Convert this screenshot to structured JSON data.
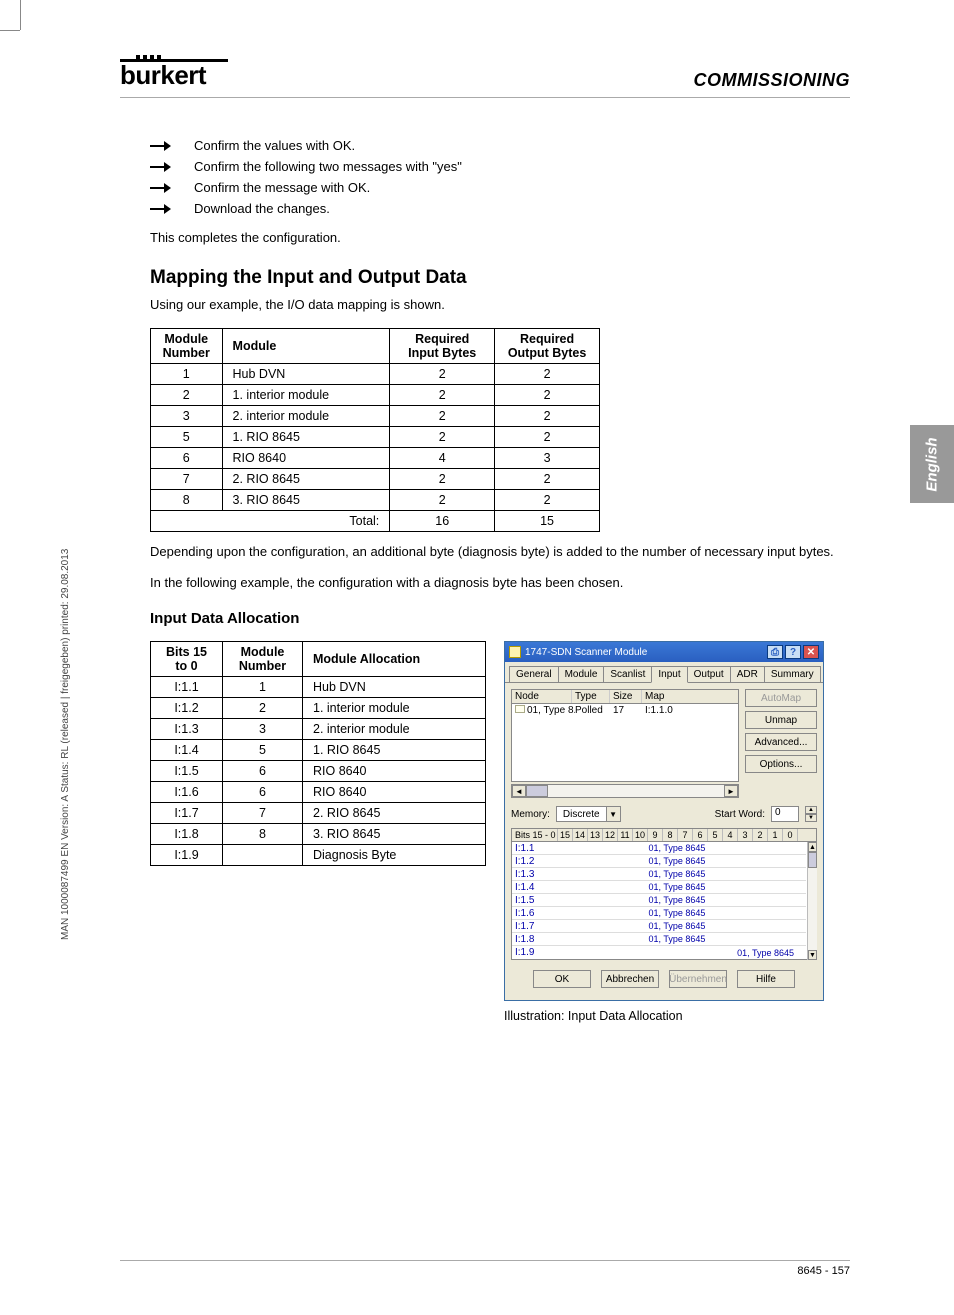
{
  "brand": "burkert",
  "section_title": "COMMISSIONING",
  "side_note": "MAN 1000087499 EN Version: A Status: RL (released | freigegeben) printed: 29.08.2013",
  "lang_tab": "English",
  "steps": [
    "Confirm the values with OK.",
    "Confirm the following two messages with \"yes\"",
    "Confirm the message with OK.",
    "Download the changes."
  ],
  "after_steps": "This completes the configuration.",
  "h2": "Mapping the Input and Output Data",
  "intro_para": "Using our example, the I/O data mapping is shown.",
  "table1": {
    "headers": [
      "Module Number",
      "Module",
      "Required Input Bytes",
      "Required Output Bytes"
    ],
    "rows": [
      [
        "1",
        "Hub DVN",
        "2",
        "2"
      ],
      [
        "2",
        "1. interior module",
        "2",
        "2"
      ],
      [
        "3",
        "2. interior module",
        "2",
        "2"
      ],
      [
        "5",
        "1. RIO 8645",
        "2",
        "2"
      ],
      [
        "6",
        "RIO 8640",
        "4",
        "3"
      ],
      [
        "7",
        "2. RIO 8645",
        "2",
        "2"
      ],
      [
        "8",
        "3. RIO 8645",
        "2",
        "2"
      ]
    ],
    "total_row": [
      "",
      "Total:",
      "16",
      "15"
    ]
  },
  "para_after_t1a": "Depending upon the configuration, an additional byte (diagnosis byte) is added to the number of necessary input bytes.",
  "para_after_t1b": "In the following example, the configuration with a diagnosis byte has been chosen.",
  "h3": "Input Data Allocation",
  "table2": {
    "headers": [
      "Bits 15 to 0",
      "Module Number",
      "Module Allocation"
    ],
    "rows": [
      [
        "I:1.1",
        "1",
        "Hub DVN"
      ],
      [
        "I:1.2",
        "2",
        "1. interior module"
      ],
      [
        "I:1.3",
        "3",
        "2. interior module"
      ],
      [
        "I:1.4",
        "5",
        "1. RIO 8645"
      ],
      [
        "I:1.5",
        "6",
        "RIO 8640"
      ],
      [
        "I:1.6",
        "6",
        "RIO 8640"
      ],
      [
        "I:1.7",
        "7",
        "2. RIO 8645"
      ],
      [
        "I:1.8",
        "8",
        "3. RIO 8645"
      ],
      [
        "I:1.9",
        "",
        "Diagnosis Byte"
      ]
    ]
  },
  "win": {
    "title": "1747-SDN Scanner Module",
    "tabs": [
      "General",
      "Module",
      "Scanlist",
      "Input",
      "Output",
      "ADR",
      "Summary"
    ],
    "active_tab": 3,
    "list_headers": [
      "Node",
      "Type",
      "Size",
      "Map"
    ],
    "list_row": [
      "01, Type 8...",
      "Polled",
      "17",
      "I:1.1.0"
    ],
    "btn_automap": "AutoMap",
    "btn_unmap": "Unmap",
    "btn_advanced": "Advanced...",
    "btn_options": "Options...",
    "mem_label": "Memory:",
    "mem_value": "Discrete",
    "startword_label": "Start Word:",
    "startword_value": "0",
    "bits_head_label": "Bits 15 - 0",
    "bits_cols": [
      "15",
      "14",
      "13",
      "12",
      "11",
      "10",
      "9",
      "8",
      "7",
      "6",
      "5",
      "4",
      "3",
      "2",
      "1",
      "0"
    ],
    "bits_rows": [
      {
        "lab": "I:1.1",
        "val": "01, Type 8645"
      },
      {
        "lab": "I:1.2",
        "val": "01, Type 8645"
      },
      {
        "lab": "I:1.3",
        "val": "01, Type 8645"
      },
      {
        "lab": "I:1.4",
        "val": "01, Type 8645"
      },
      {
        "lab": "I:1.5",
        "val": "01, Type 8645"
      },
      {
        "lab": "I:1.6",
        "val": "01, Type 8645"
      },
      {
        "lab": "I:1.7",
        "val": "01, Type 8645"
      },
      {
        "lab": "I:1.8",
        "val": "01, Type 8645"
      },
      {
        "lab": "I:1.9",
        "val": "01, Type 8645"
      }
    ],
    "btn_ok": "OK",
    "btn_cancel": "Abbrechen",
    "btn_apply": "Übernehmen",
    "btn_help": "Hilfe"
  },
  "caption": "Illustration: Input Data Allocation",
  "footer": "8645 - 157"
}
